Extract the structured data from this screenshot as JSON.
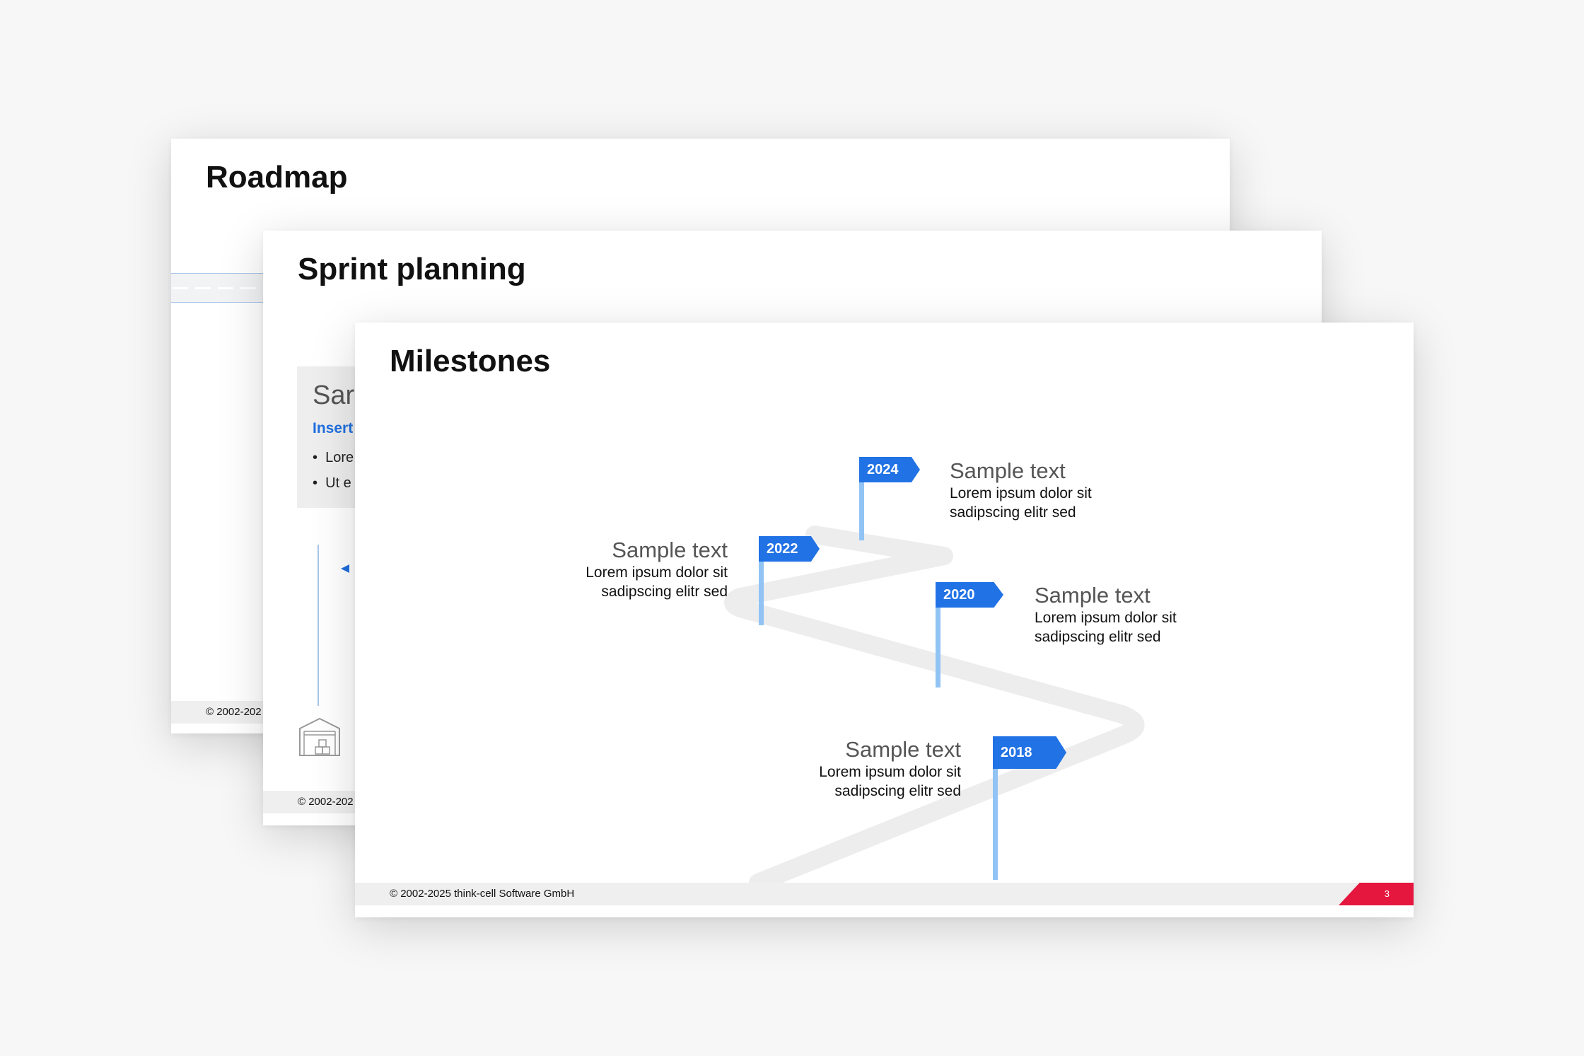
{
  "slides": [
    {
      "title": "Roadmap",
      "footer": "© 2002-202"
    },
    {
      "title": "Sprint planning",
      "card": {
        "title": "Sar",
        "subtitle": "Insert",
        "bullets": [
          "Lore",
          "Ut e"
        ]
      },
      "footer": "© 2002-202"
    },
    {
      "title": "Milestones",
      "footer": "© 2002-2025 think-cell Software GmbH",
      "page_number": "3",
      "accent_color": "#e5173f",
      "flag_color": "#2172e5",
      "milestones": [
        {
          "year": "2024",
          "title": "Sample text",
          "line1": "Lorem ipsum dolor sit",
          "line2": "sadipscing elitr sed"
        },
        {
          "year": "2022",
          "title": "Sample text",
          "line1": "Lorem ipsum dolor sit",
          "line2": "sadipscing elitr sed"
        },
        {
          "year": "2020",
          "title": "Sample text",
          "line1": "Lorem ipsum dolor sit",
          "line2": "sadipscing elitr sed"
        },
        {
          "year": "2018",
          "title": "Sample text",
          "line1": "Lorem ipsum dolor sit",
          "line2": "sadipscing elitr sed"
        }
      ]
    }
  ]
}
